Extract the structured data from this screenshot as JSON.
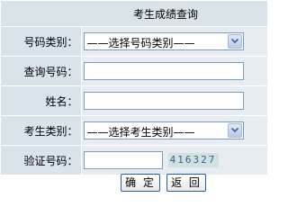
{
  "form": {
    "title": "考生成绩查询",
    "rows": [
      {
        "label": "号码类别：",
        "type": "select",
        "value": "——选择号码类别——"
      },
      {
        "label": "查询号码：",
        "type": "text",
        "value": ""
      },
      {
        "label": "姓名：",
        "type": "text",
        "value": ""
      },
      {
        "label": "考生类别：",
        "type": "select",
        "value": "——选择考生类别——"
      },
      {
        "label": "验证号码：",
        "type": "captcha",
        "value": "",
        "captcha": "416327"
      }
    ]
  },
  "buttons": {
    "confirm": "确 定",
    "back": "返 回"
  },
  "icons": {
    "dropdown": "chevron-down-icon"
  },
  "colors": {
    "label_bg": "#dbe3ea",
    "field_bg": "#e6ecf1",
    "border": "#7f9db9"
  }
}
